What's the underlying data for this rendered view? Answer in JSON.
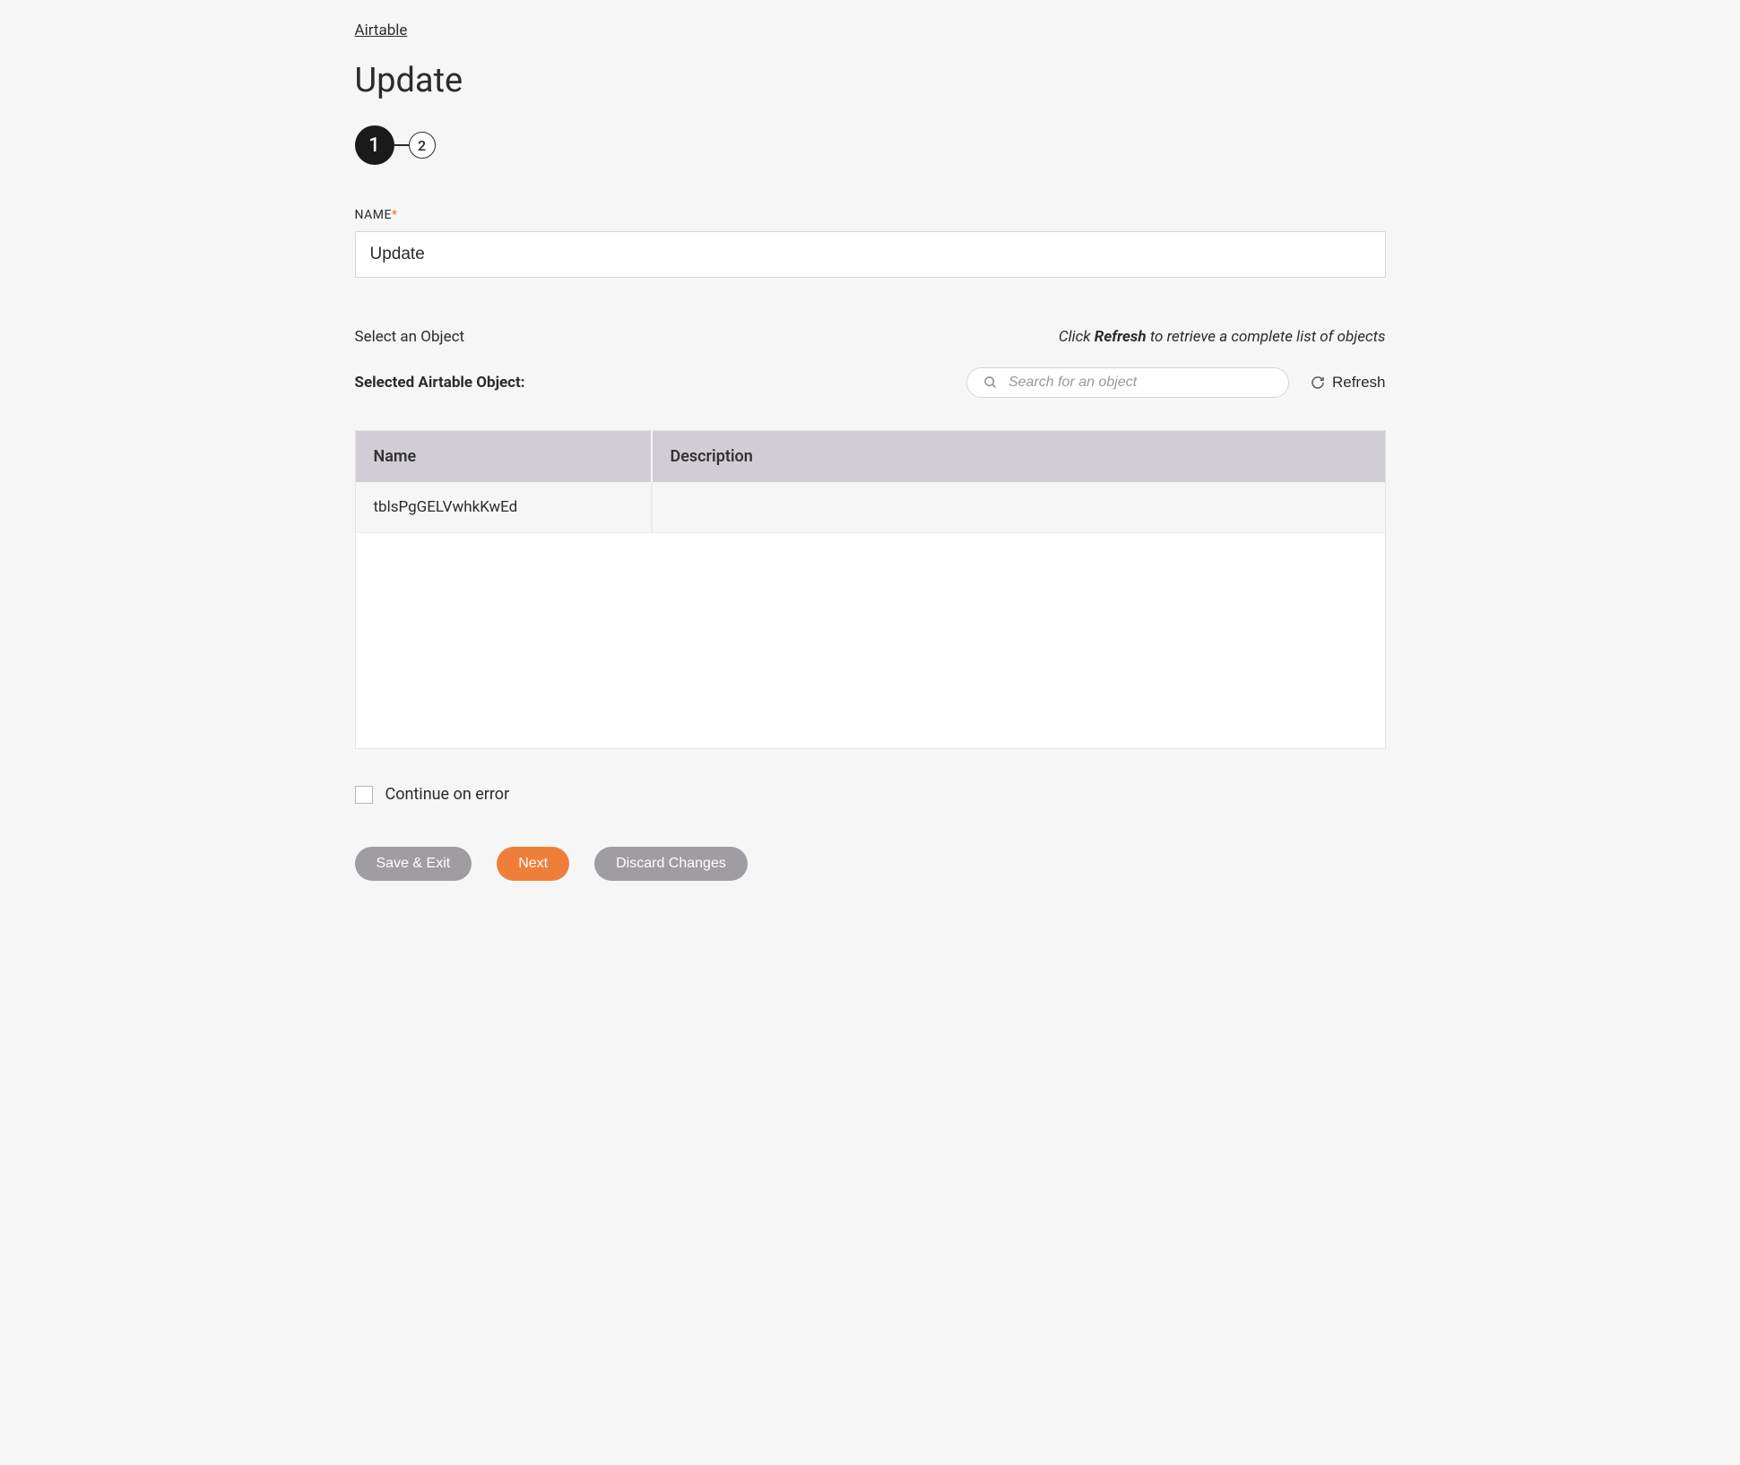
{
  "breadcrumb": {
    "label": "Airtable"
  },
  "page": {
    "title": "Update"
  },
  "stepper": {
    "steps": [
      "1",
      "2"
    ],
    "active_index": 0
  },
  "form": {
    "name_label": "NAME",
    "name_value": "Update"
  },
  "object_section": {
    "select_label": "Select an Object",
    "hint_prefix": "Click ",
    "hint_bold": "Refresh",
    "hint_suffix": " to retrieve a complete list of objects",
    "selected_label": "Selected Airtable Object:",
    "search_placeholder": "Search for an object",
    "refresh_label": "Refresh"
  },
  "table": {
    "headers": {
      "name": "Name",
      "description": "Description"
    },
    "rows": [
      {
        "name": "tblsPgGELVwhkKwEd",
        "description": ""
      }
    ]
  },
  "options": {
    "continue_on_error_label": "Continue on error",
    "continue_on_error_checked": false
  },
  "buttons": {
    "save_exit": "Save & Exit",
    "next": "Next",
    "discard": "Discard Changes"
  }
}
